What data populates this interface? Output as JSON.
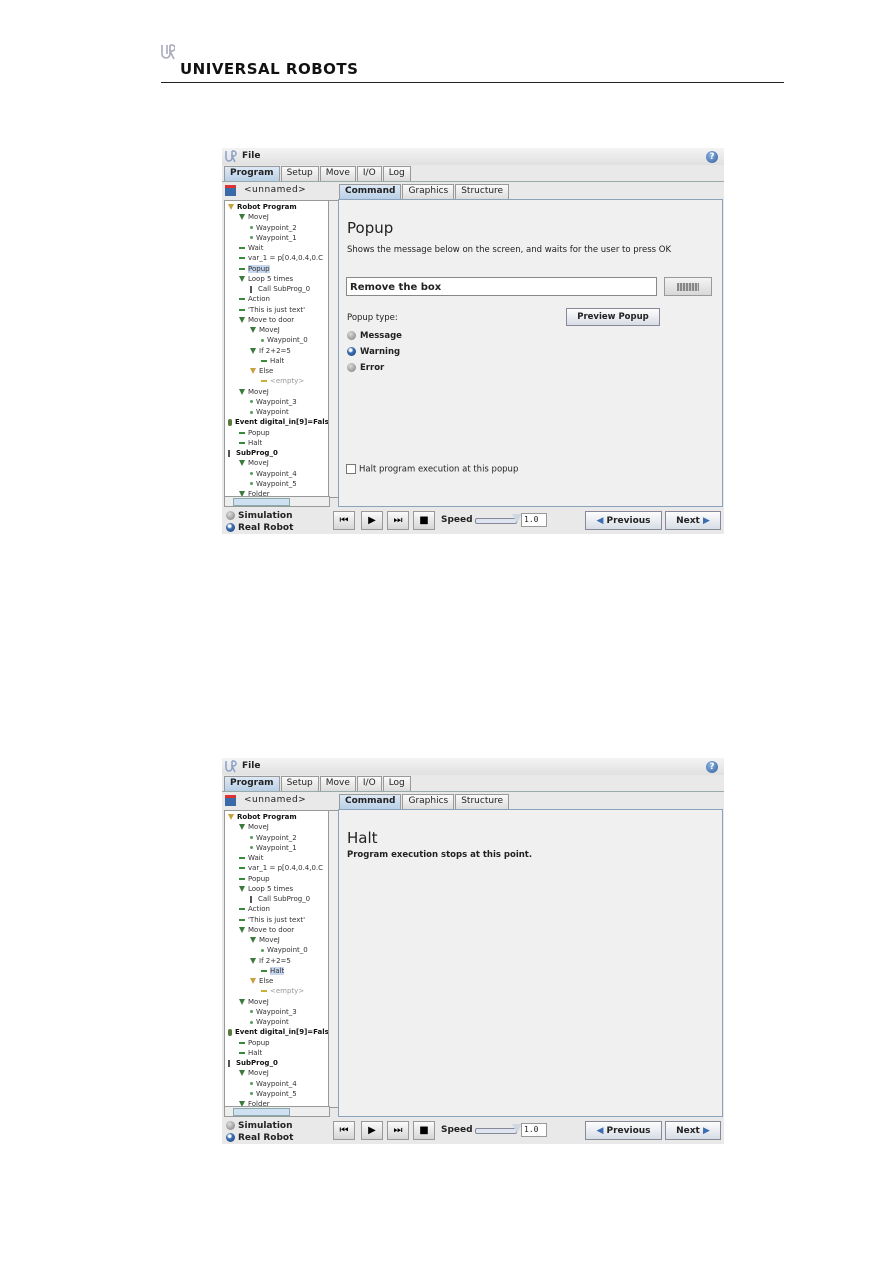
{
  "header": {
    "brand": "UNIVERSAL ROBOTS",
    "logo_text": "UR"
  },
  "screens": [
    {
      "menu": "File",
      "main_tabs": [
        "Program",
        "Setup",
        "Move",
        "I/O",
        "Log"
      ],
      "active_main_tab": 0,
      "program_name": "<unnamed>",
      "sub_tabs": [
        "Command",
        "Graphics",
        "Structure"
      ],
      "active_sub_tab": 0,
      "selected_index": 6,
      "command": {
        "title": "Popup",
        "description": "Shows the message below on the screen, and waits for the user to press OK",
        "message_value": "Remove the box",
        "popup_type_label": "Popup type:",
        "preview_button": "Preview Popup",
        "popup_types": [
          {
            "label": "Message",
            "selected": false
          },
          {
            "label": "Warning",
            "selected": true
          },
          {
            "label": "Error",
            "selected": false
          }
        ],
        "halt_checkbox_label": "Halt program execution at this popup",
        "halt_checked": false
      },
      "modes": [
        {
          "label": "Simulation",
          "selected": false
        },
        {
          "label": "Real Robot",
          "selected": true
        }
      ],
      "speed_label": "Speed",
      "speed_value": "1.0",
      "previous_label": "Previous",
      "next_label": "Next"
    },
    {
      "menu": "File",
      "main_tabs": [
        "Program",
        "Setup",
        "Move",
        "I/O",
        "Log"
      ],
      "active_main_tab": 0,
      "program_name": "<unnamed>",
      "sub_tabs": [
        "Command",
        "Graphics",
        "Structure"
      ],
      "active_sub_tab": 0,
      "selected_index": 15,
      "command": {
        "title": "Halt",
        "description": "Program execution stops at this point."
      },
      "modes": [
        {
          "label": "Simulation",
          "selected": false
        },
        {
          "label": "Real Robot",
          "selected": true
        }
      ],
      "speed_label": "Speed",
      "speed_value": "1.0",
      "previous_label": "Previous",
      "next_label": "Next"
    }
  ],
  "tree": [
    {
      "label": "Robot Program",
      "level": 0,
      "icon": "trio",
      "bold": true
    },
    {
      "label": "MoveJ",
      "level": 1,
      "icon": "tri"
    },
    {
      "label": "Waypoint_2",
      "level": 2,
      "icon": "dot"
    },
    {
      "label": "Waypoint_1",
      "level": 2,
      "icon": "dot"
    },
    {
      "label": "Wait",
      "level": 1,
      "icon": "bar"
    },
    {
      "label": "var_1 = p[0.4,0.4,0.C",
      "level": 1,
      "icon": "bar"
    },
    {
      "label": "Popup",
      "level": 1,
      "icon": "bar"
    },
    {
      "label": "Loop 5 times",
      "level": 1,
      "icon": "tri"
    },
    {
      "label": "Call SubProg_0",
      "level": 2,
      "icon": "sub"
    },
    {
      "label": "Action",
      "level": 1,
      "icon": "bar"
    },
    {
      "label": "'This is just text'",
      "level": 1,
      "icon": "bar"
    },
    {
      "label": "Move to door",
      "level": 1,
      "icon": "tri"
    },
    {
      "label": "MoveJ",
      "level": 2,
      "icon": "tri"
    },
    {
      "label": "Waypoint_0",
      "level": 3,
      "icon": "dot"
    },
    {
      "label": "If 2+2=5",
      "level": 2,
      "icon": "tri"
    },
    {
      "label": "Halt",
      "level": 3,
      "icon": "bar"
    },
    {
      "label": "Else",
      "level": 2,
      "icon": "trio"
    },
    {
      "label": "<empty>",
      "level": 3,
      "icon": "bary",
      "gray": true
    },
    {
      "label": "MoveJ",
      "level": 1,
      "icon": "tri"
    },
    {
      "label": "Waypoint_3",
      "level": 2,
      "icon": "dot"
    },
    {
      "label": "Waypoint",
      "level": 2,
      "icon": "dot"
    },
    {
      "label": "Event digital_in[9]=Fals",
      "level": 0,
      "icon": "ev",
      "bold": true
    },
    {
      "label": "Popup",
      "level": 1,
      "icon": "bar"
    },
    {
      "label": "Halt",
      "level": 1,
      "icon": "bar"
    },
    {
      "label": "SubProg_0",
      "level": 0,
      "icon": "sub",
      "bold": true
    },
    {
      "label": "MoveJ",
      "level": 1,
      "icon": "tri"
    },
    {
      "label": "Waypoint_4",
      "level": 2,
      "icon": "dot"
    },
    {
      "label": "Waypoint_5",
      "level": 2,
      "icon": "dot"
    },
    {
      "label": "Folder",
      "level": 1,
      "icon": "tri"
    }
  ],
  "colors": {
    "accent": "#3b6db0",
    "selection": "#c6d7ef",
    "panel_border": "#8aa3bd"
  }
}
